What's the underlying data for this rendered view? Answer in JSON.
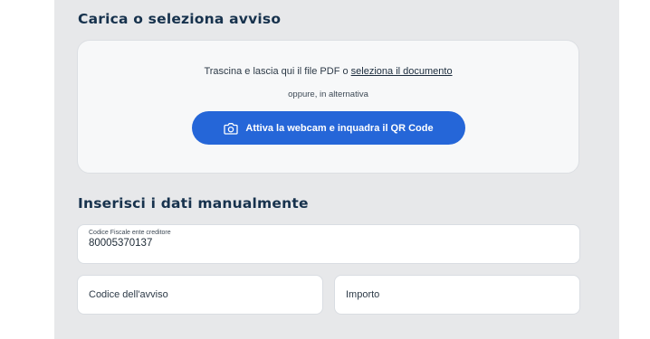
{
  "upload_section": {
    "title": "Carica o seleziona avviso",
    "drop_text": "Trascina e lascia qui il file PDF o",
    "select_link": "seleziona il documento",
    "or_text": "oppure, in alternativa",
    "webcam_button": "Attiva la webcam e inquadra il QR Code",
    "webcam_icon": "camera-icon"
  },
  "manual_section": {
    "title": "Inserisci i dati manualmente",
    "fields": [
      {
        "label": "Codice Fiscale ente creditore",
        "value": "80005370137"
      },
      {
        "placeholder": "Codice dell'avviso"
      },
      {
        "placeholder": "Importo"
      }
    ]
  },
  "colors": {
    "panel_bg": "#e7e8ea",
    "title": "#17324d",
    "primary": "#2566d8"
  }
}
